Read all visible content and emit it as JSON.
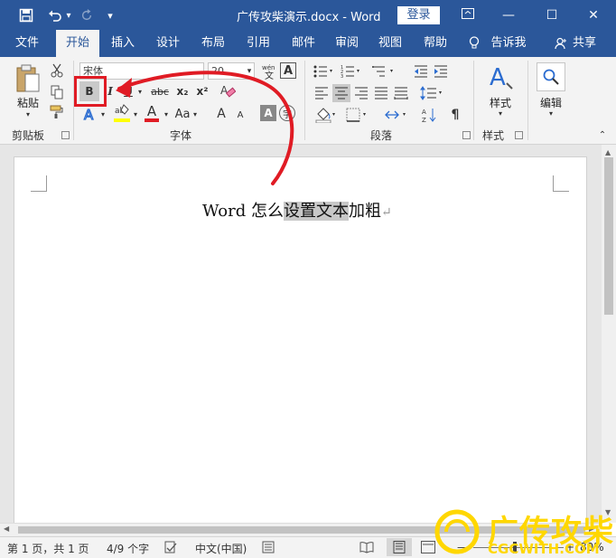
{
  "titlebar": {
    "document_title": "广传攻柴演示.docx  -  Word",
    "login_label": "登录",
    "minimize_glyph": "—",
    "maximize_glyph": "☐",
    "close_glyph": "✕",
    "save_glyph": "💾",
    "undo_glyph": "↶",
    "redo_glyph": "↻",
    "customize_glyph": "▾"
  },
  "tabs": {
    "file": "文件",
    "home": "开始",
    "insert": "插入",
    "design": "设计",
    "layout": "布局",
    "references": "引用",
    "mailings": "邮件",
    "review": "审阅",
    "view": "视图",
    "help": "帮助",
    "tellme": "告诉我",
    "share": "共享"
  },
  "ribbon": {
    "clipboard": {
      "paste_label": "粘贴",
      "group_label": "剪贴板"
    },
    "font": {
      "font_name": "宋体",
      "font_size": "20",
      "bold_label": "B",
      "italic_label": "I",
      "underline_label": "U",
      "strike_label": "abc",
      "subscript_label": "x₂",
      "superscript_label": "x²",
      "font_color_label": "A",
      "case_label": "Aa",
      "grow_label": "A",
      "shrink_label": "A",
      "group_label": "字体"
    },
    "paragraph": {
      "group_label": "段落"
    },
    "styles": {
      "styles_label": "样式",
      "group_label": "样式"
    },
    "editing": {
      "editing_label": "编辑"
    }
  },
  "document": {
    "text_before": "Word 怎么",
    "text_selected": "设置文本",
    "text_after": "加粗",
    "para_mark": "↵"
  },
  "status": {
    "page_info": "第 1 页，共 1 页",
    "word_count": "4/9 个字",
    "language": "中文(中国)",
    "zoom": "80%"
  },
  "watermark": {
    "brand_cn": "广传攻柴",
    "brand_url": "CGCWITH.COM"
  },
  "colors": {
    "accent": "#2b579a",
    "highlight_box": "#e01b24",
    "arrow": "#e01b24"
  }
}
